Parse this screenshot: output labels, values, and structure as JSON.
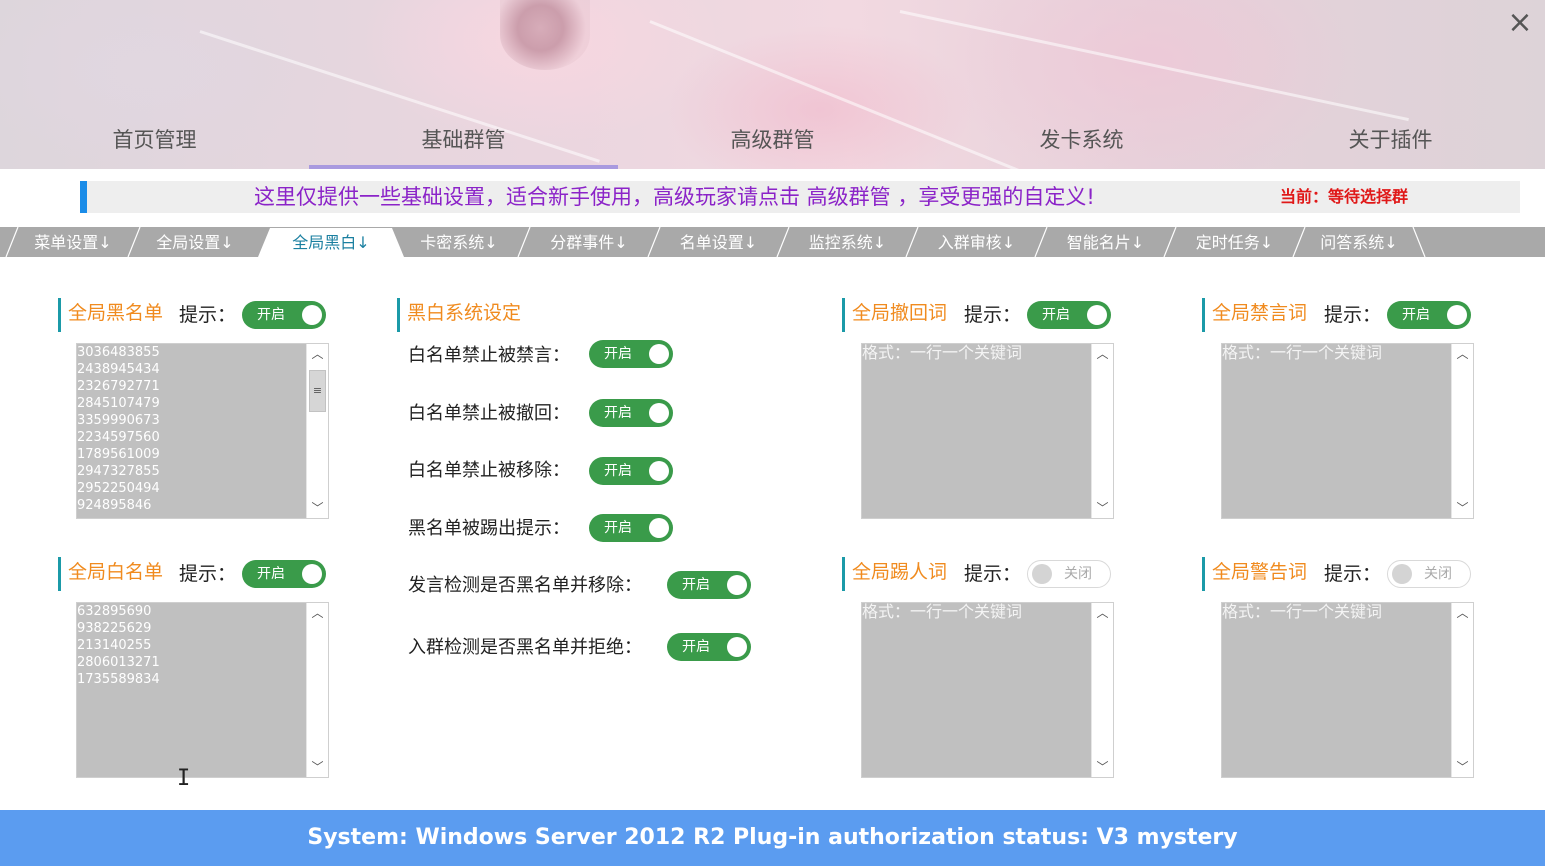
{
  "window": {
    "close_glyph": "×"
  },
  "nav": [
    {
      "label": "首页管理"
    },
    {
      "label": "基础群管"
    },
    {
      "label": "高级群管"
    },
    {
      "label": "发卡系统"
    },
    {
      "label": "关于插件"
    }
  ],
  "nav_active": 1,
  "notice": {
    "text": "这里仅提供一些基础设置，适合新手使用，高级玩家请点击 高级群管 ，享受更强的自定义!",
    "current": "当前：等待选择群"
  },
  "subtabs": [
    "菜单设置↓",
    "全局设置↓",
    "全局黑白↓",
    "卡密系统↓",
    "分群事件↓",
    "名单设置↓",
    "监控系统↓",
    "入群审核↓",
    "智能名片↓",
    "定时任务↓",
    "问答系统↓"
  ],
  "subtab_active": 2,
  "hint_label": "提示：",
  "toggle_on": "开启",
  "toggle_off": "关闭",
  "blacklist": {
    "title": "全局黑名单",
    "enabled": true,
    "items": "3036483855\n2438945434\n2326792771\n2845107479\n3359990673\n2234597560\n1789561009\n2947327855\n2952250494\n924895846"
  },
  "whitelist": {
    "title": "全局白名单",
    "enabled": true,
    "items": "632895690\n938225629\n213140255\n2806013271\n1735589834"
  },
  "bw_settings": {
    "title": "黑白系统设定",
    "rows": [
      {
        "label": "白名单禁止被禁言：",
        "enabled": true
      },
      {
        "label": "白名单禁止被撤回：",
        "enabled": true
      },
      {
        "label": "白名单禁止被移除：",
        "enabled": true
      },
      {
        "label": "黑名单被踢出提示：",
        "enabled": true
      },
      {
        "label": "发言检测是否黑名单并移除：",
        "enabled": true
      },
      {
        "label": "入群检测是否黑名单并拒绝：",
        "enabled": true
      }
    ]
  },
  "recall_words": {
    "title": "全局撤回词",
    "enabled": true,
    "placeholder": "格式：一行一个关键词"
  },
  "mute_words": {
    "title": "全局禁言词",
    "enabled": true,
    "placeholder": "格式：一行一个关键词"
  },
  "kick_words": {
    "title": "全局踢人词",
    "enabled": false,
    "placeholder": "格式：一行一个关键词"
  },
  "warn_words": {
    "title": "全局警告词",
    "enabled": false,
    "placeholder": "格式：一行一个关键词"
  },
  "footer": {
    "text": "System:  Windows Server 2012 R2  Plug-in authorization status:  V3 mystery"
  },
  "icons": {
    "close": "close-icon",
    "scroll_up": "chevron-up-icon",
    "scroll_down": "chevron-down-icon",
    "text_cursor": "text-cursor-icon"
  },
  "colors": {
    "accent_orange": "#f08b1f",
    "toggle_on": "#3a9b4a",
    "notice_text": "#8b23c8",
    "current_text": "#e01818",
    "footer_bg": "#5b9cf0",
    "nav_underline": "#a99adf",
    "subtab_bar": "#a9a9a9"
  }
}
